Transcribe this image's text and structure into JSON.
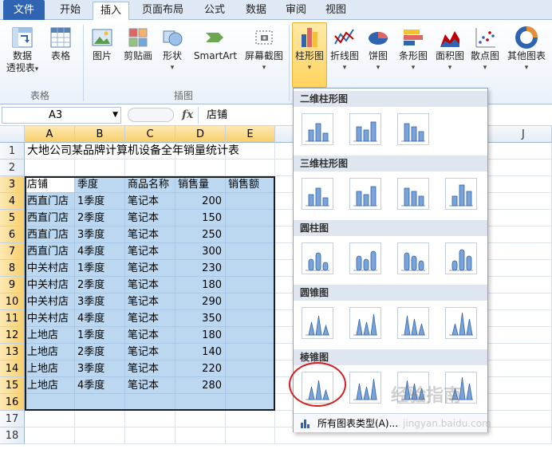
{
  "ribbon_tabs": [
    {
      "label": "文件"
    },
    {
      "label": "开始"
    },
    {
      "label": "插入"
    },
    {
      "label": "页面布局"
    },
    {
      "label": "公式"
    },
    {
      "label": "数据"
    },
    {
      "label": "审阅"
    },
    {
      "label": "视图"
    }
  ],
  "ribbon": {
    "pivot": {
      "label1": "数据",
      "label2": "透视表"
    },
    "table": "表格",
    "group_tables": "表格",
    "picture": "图片",
    "clipart": "剪贴画",
    "shapes": "形状",
    "smartart": "SmartArt",
    "screenshot": "屏幕截图",
    "group_illustrations": "插图",
    "column": "柱形图",
    "line": "折线图",
    "pie": "饼图",
    "bar": "条形图",
    "area": "面积图",
    "scatter": "散点图",
    "other": "其他图表"
  },
  "formula_bar": {
    "name_box": "A3",
    "fx": "fx",
    "content": "店铺"
  },
  "columns": [
    "A",
    "B",
    "C",
    "D",
    "E",
    "J"
  ],
  "rows": [
    "1",
    "2",
    "3",
    "4",
    "5",
    "6",
    "7",
    "8",
    "9",
    "10",
    "11",
    "12",
    "13",
    "14",
    "15",
    "16",
    "17",
    "18"
  ],
  "sheet": {
    "title": "大地公司某品牌计算机设备全年销量统计表",
    "headers": [
      "店铺",
      "季度",
      "商品名称",
      "销售量",
      "销售额"
    ],
    "data": [
      [
        "西直门店",
        "1季度",
        "笔记本",
        "200"
      ],
      [
        "西直门店",
        "2季度",
        "笔记本",
        "150"
      ],
      [
        "西直门店",
        "3季度",
        "笔记本",
        "250"
      ],
      [
        "西直门店",
        "4季度",
        "笔记本",
        "300"
      ],
      [
        "中关村店",
        "1季度",
        "笔记本",
        "230"
      ],
      [
        "中关村店",
        "2季度",
        "笔记本",
        "180"
      ],
      [
        "中关村店",
        "3季度",
        "笔记本",
        "290"
      ],
      [
        "中关村店",
        "4季度",
        "笔记本",
        "350"
      ],
      [
        "上地店",
        "1季度",
        "笔记本",
        "180"
      ],
      [
        "上地店",
        "2季度",
        "笔记本",
        "140"
      ],
      [
        "上地店",
        "3季度",
        "笔记本",
        "220"
      ],
      [
        "上地店",
        "4季度",
        "笔记本",
        "280"
      ]
    ]
  },
  "gallery": {
    "sections": [
      "二维柱形图",
      "三维柱形图",
      "圆柱图",
      "圆锥图",
      "棱锥图"
    ],
    "footer": "所有图表类型(A)..."
  },
  "watermark": {
    "line1": "经验指南",
    "line2": "jingyan.baidu.com"
  },
  "colors": {
    "selection": "#bcd8f1",
    "accent": "#2f64b2",
    "highlight_red": "#d42020"
  }
}
